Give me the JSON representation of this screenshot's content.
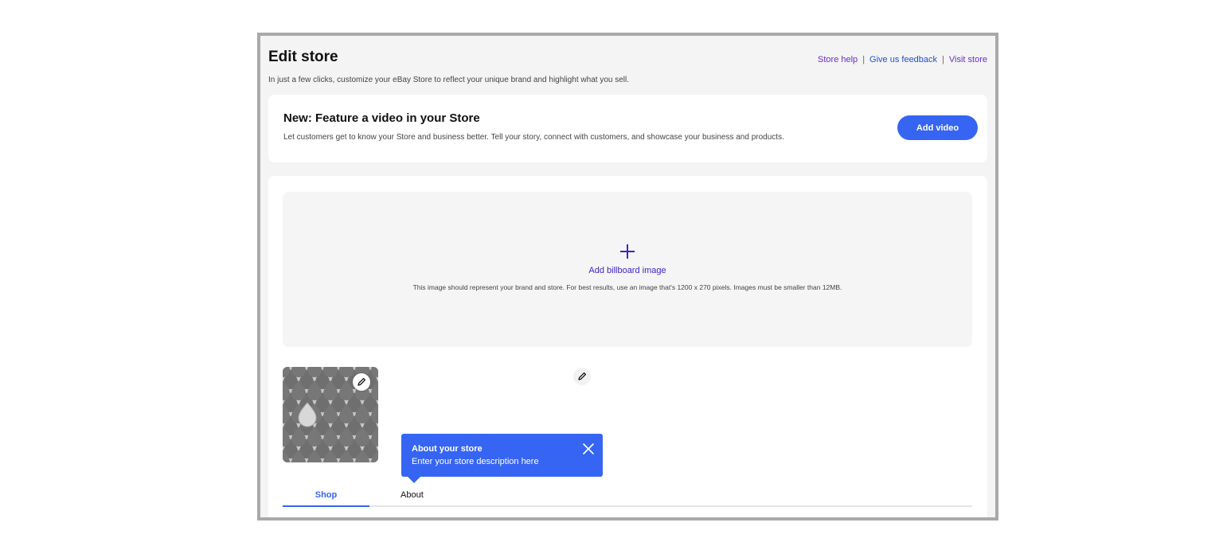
{
  "header": {
    "title": "Edit store",
    "subtitle": "In just a few clicks, customize your eBay Store to reflect your unique brand and highlight what you sell.",
    "links": {
      "store_help": "Store help",
      "separator": "|",
      "give_feedback": "Give us feedback",
      "visit_store": "Visit store"
    }
  },
  "video_banner": {
    "title": "New: Feature a video in your Store",
    "description": "Let customers get to know your Store and business better. Tell your story, connect with customers, and showcase your business and products.",
    "button_label": "Add video"
  },
  "billboard": {
    "label": "Add billboard image",
    "hint": "This image should represent your brand and store. For best results, use an image that's 1200 x 270 pixels. Images must be smaller than 12MB."
  },
  "tooltip": {
    "title": "About your store",
    "text": "Enter your store description here"
  },
  "tabs": [
    {
      "label": "Shop",
      "active": true
    },
    {
      "label": "About",
      "active": false
    }
  ],
  "colors": {
    "accent": "#3665f3",
    "link_purple": "#6b2ec9",
    "link_blue": "#1f4fcf",
    "billboard_accent": "#3c25c7"
  },
  "icons": [
    "plus-icon",
    "pencil-icon",
    "close-icon"
  ]
}
